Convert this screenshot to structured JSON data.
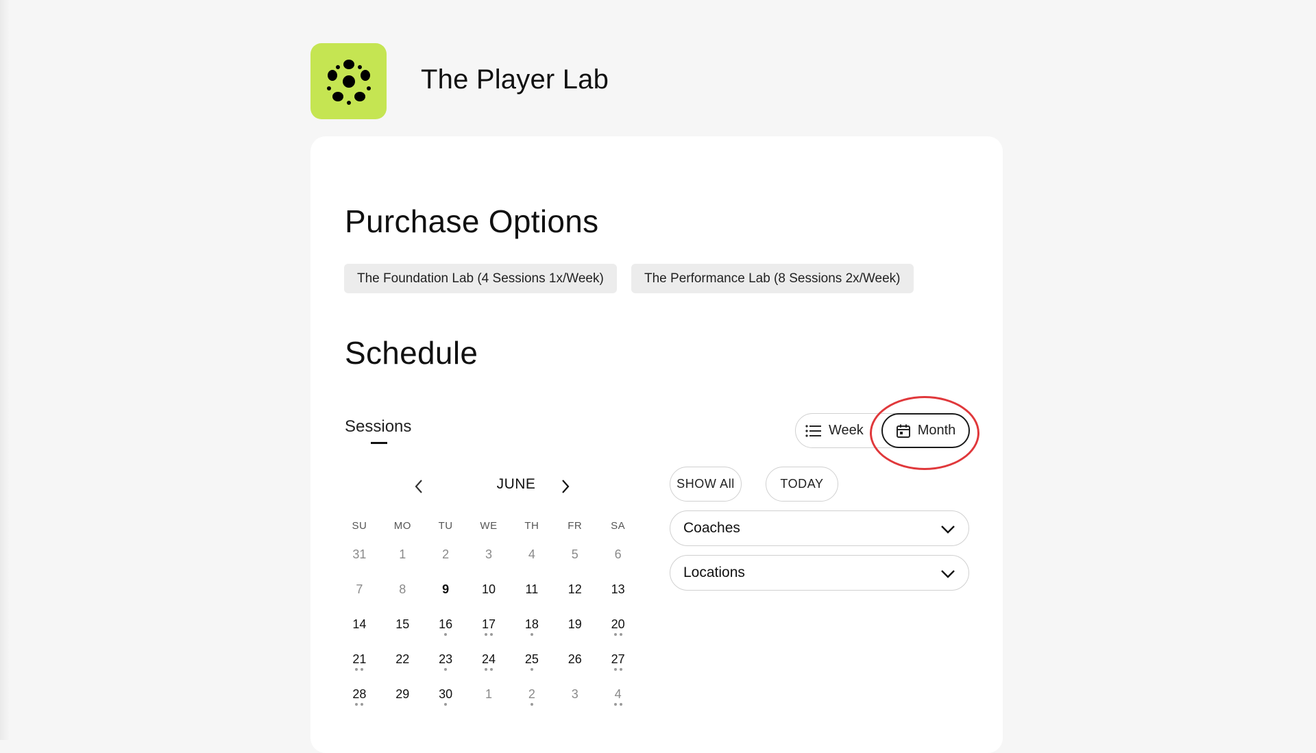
{
  "brand": {
    "name": "The Player Lab",
    "logo_icon": "soccer-ball-icon",
    "accent": "#c5e552"
  },
  "purchase": {
    "title": "Purchase Options",
    "options": [
      "The Foundation Lab (4 Sessions 1x/Week)",
      "The Performance Lab (8 Sessions 2x/Week)"
    ]
  },
  "schedule": {
    "title": "Schedule",
    "tab": "Sessions",
    "view": {
      "week_label": "Week",
      "month_label": "Month",
      "selected": "Month",
      "highlight_color": "#e0383b"
    },
    "calendar": {
      "month": "JUNE",
      "weekdays": [
        "SU",
        "MO",
        "TU",
        "WE",
        "TH",
        "FR",
        "SA"
      ],
      "weeks": [
        [
          {
            "d": "31",
            "s": "muted",
            "dots": 0
          },
          {
            "d": "1",
            "s": "muted",
            "dots": 0
          },
          {
            "d": "2",
            "s": "muted",
            "dots": 0
          },
          {
            "d": "3",
            "s": "muted",
            "dots": 0
          },
          {
            "d": "4",
            "s": "muted",
            "dots": 0
          },
          {
            "d": "5",
            "s": "muted",
            "dots": 0
          },
          {
            "d": "6",
            "s": "muted",
            "dots": 0
          }
        ],
        [
          {
            "d": "7",
            "s": "muted",
            "dots": 0
          },
          {
            "d": "8",
            "s": "muted",
            "dots": 0
          },
          {
            "d": "9",
            "s": "bold",
            "dots": 0
          },
          {
            "d": "10",
            "s": "active",
            "dots": 0
          },
          {
            "d": "11",
            "s": "active",
            "dots": 0
          },
          {
            "d": "12",
            "s": "active",
            "dots": 0
          },
          {
            "d": "13",
            "s": "active",
            "dots": 0
          }
        ],
        [
          {
            "d": "14",
            "s": "active",
            "dots": 0
          },
          {
            "d": "15",
            "s": "active",
            "dots": 0
          },
          {
            "d": "16",
            "s": "active",
            "dots": 1
          },
          {
            "d": "17",
            "s": "active",
            "dots": 2
          },
          {
            "d": "18",
            "s": "active",
            "dots": 1
          },
          {
            "d": "19",
            "s": "active",
            "dots": 0
          },
          {
            "d": "20",
            "s": "active",
            "dots": 2
          }
        ],
        [
          {
            "d": "21",
            "s": "active",
            "dots": 2
          },
          {
            "d": "22",
            "s": "active",
            "dots": 0
          },
          {
            "d": "23",
            "s": "active",
            "dots": 1
          },
          {
            "d": "24",
            "s": "active",
            "dots": 2
          },
          {
            "d": "25",
            "s": "active",
            "dots": 1
          },
          {
            "d": "26",
            "s": "active",
            "dots": 0
          },
          {
            "d": "27",
            "s": "active",
            "dots": 2
          }
        ],
        [
          {
            "d": "28",
            "s": "active",
            "dots": 2
          },
          {
            "d": "29",
            "s": "active",
            "dots": 0
          },
          {
            "d": "30",
            "s": "active",
            "dots": 1
          },
          {
            "d": "1",
            "s": "muted",
            "dots": 0
          },
          {
            "d": "2",
            "s": "muted",
            "dots": 1
          },
          {
            "d": "3",
            "s": "muted",
            "dots": 0
          },
          {
            "d": "4",
            "s": "muted",
            "dots": 2
          }
        ]
      ]
    },
    "filters": {
      "show_all": "SHOW All",
      "today": "TODAY",
      "coaches": "Coaches",
      "locations": "Locations"
    }
  }
}
